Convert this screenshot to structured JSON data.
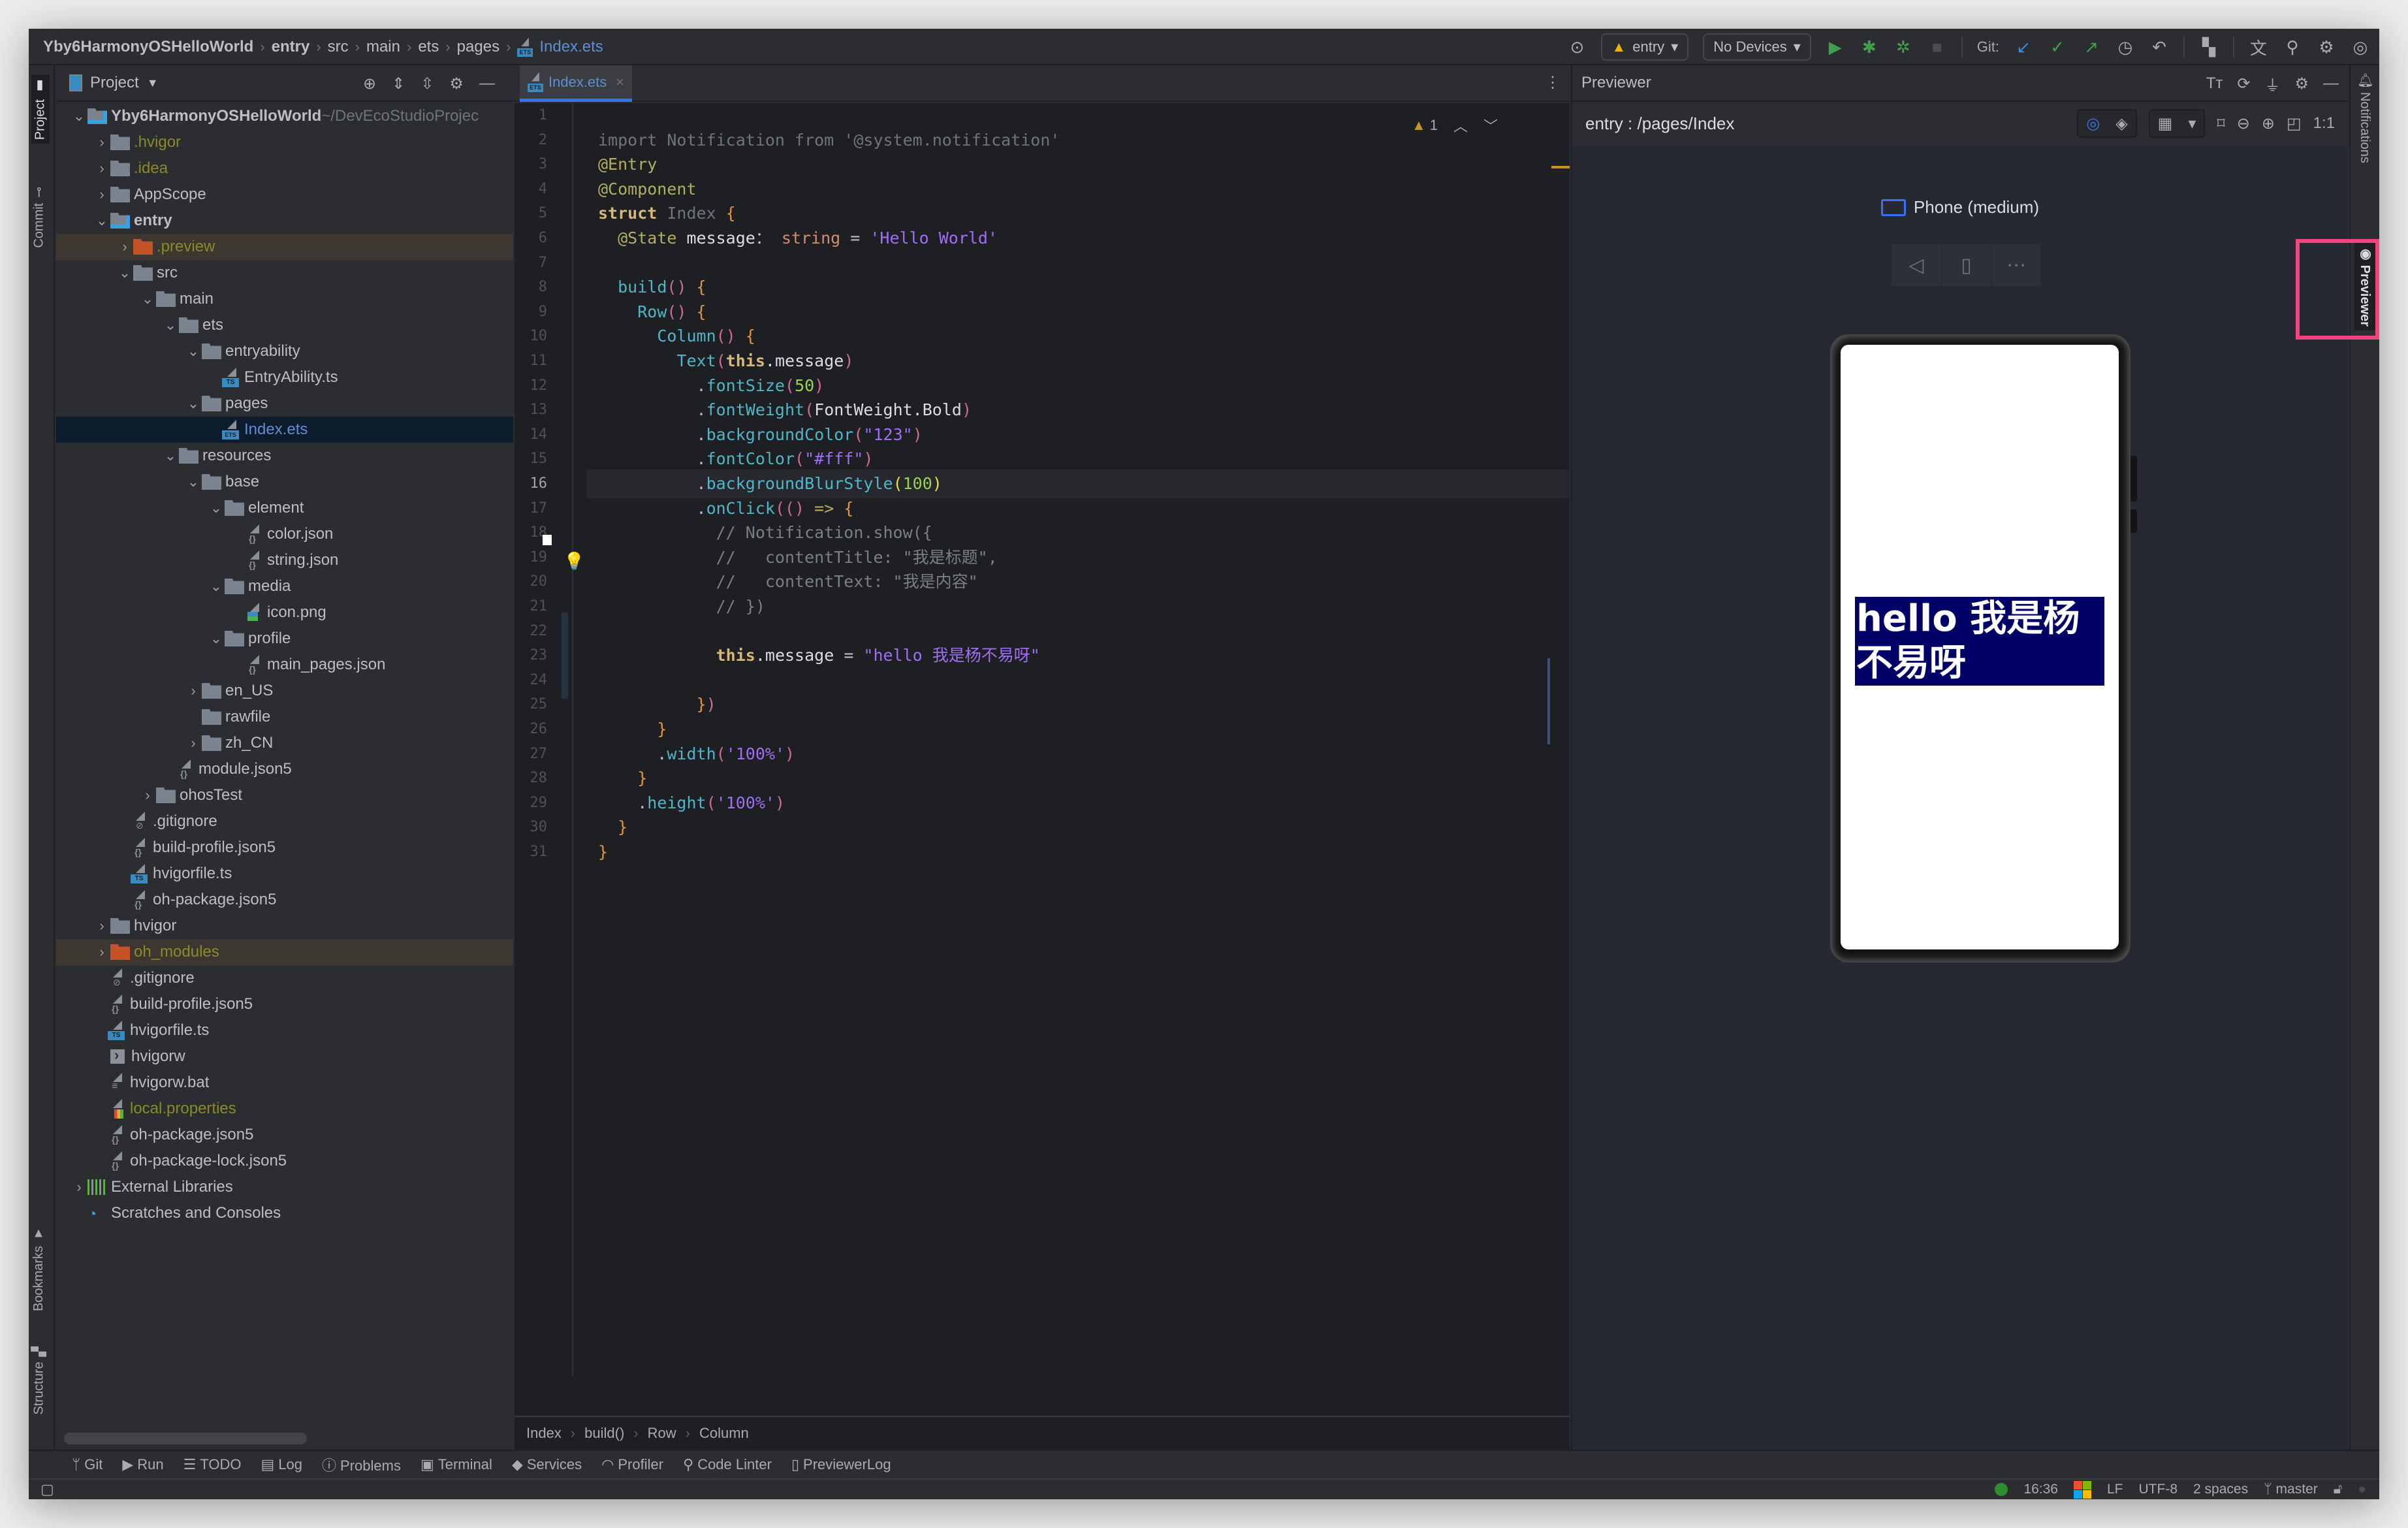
{
  "navbar": {
    "breadcrumb": [
      "Yby6HarmonyOSHelloWorld",
      "entry",
      "src",
      "main",
      "ets",
      "pages",
      "Index.ets"
    ],
    "module_selector": "entry",
    "device_selector": "No Devices",
    "git_label": "Git:"
  },
  "side_stripe_left": [
    "Project",
    "Commit",
    "Bookmarks",
    "Structure"
  ],
  "side_stripe_right": [
    "Notifications",
    "Previewer"
  ],
  "project": {
    "title": "Project",
    "tree": [
      {
        "depth": 0,
        "label": "Yby6HarmonyOSHelloWorld",
        "suffix": " ~/DevEcoStudioProjec",
        "type": "module",
        "chev": "down",
        "bold": true
      },
      {
        "depth": 1,
        "label": ".hvigor",
        "type": "folder",
        "chev": "right",
        "color": "olive"
      },
      {
        "depth": 1,
        "label": ".idea",
        "type": "folder",
        "chev": "right",
        "color": "olive"
      },
      {
        "depth": 1,
        "label": "AppScope",
        "type": "folder",
        "chev": "right"
      },
      {
        "depth": 1,
        "label": "entry",
        "type": "module",
        "chev": "down",
        "bold": true
      },
      {
        "depth": 2,
        "label": ".preview",
        "type": "folder-red",
        "chev": "right",
        "color": "olive",
        "hl": "brown"
      },
      {
        "depth": 2,
        "label": "src",
        "type": "folder",
        "chev": "down"
      },
      {
        "depth": 3,
        "label": "main",
        "type": "folder",
        "chev": "down"
      },
      {
        "depth": 4,
        "label": "ets",
        "type": "folder",
        "chev": "down"
      },
      {
        "depth": 5,
        "label": "entryability",
        "type": "folder",
        "chev": "down"
      },
      {
        "depth": 6,
        "label": "EntryAbility.ts",
        "type": "ts"
      },
      {
        "depth": 5,
        "label": "pages",
        "type": "folder",
        "chev": "down"
      },
      {
        "depth": 6,
        "label": "Index.ets",
        "type": "ets",
        "color": "blue",
        "hl": "sel"
      },
      {
        "depth": 4,
        "label": "resources",
        "type": "folder",
        "chev": "down"
      },
      {
        "depth": 5,
        "label": "base",
        "type": "folder",
        "chev": "down"
      },
      {
        "depth": 6,
        "label": "element",
        "type": "folder",
        "chev": "down"
      },
      {
        "depth": 7,
        "label": "color.json",
        "type": "json"
      },
      {
        "depth": 7,
        "label": "string.json",
        "type": "json"
      },
      {
        "depth": 6,
        "label": "media",
        "type": "folder",
        "chev": "down"
      },
      {
        "depth": 7,
        "label": "icon.png",
        "type": "img"
      },
      {
        "depth": 6,
        "label": "profile",
        "type": "folder",
        "chev": "down"
      },
      {
        "depth": 7,
        "label": "main_pages.json",
        "type": "json"
      },
      {
        "depth": 5,
        "label": "en_US",
        "type": "folder",
        "chev": "right"
      },
      {
        "depth": 5,
        "label": "rawfile",
        "type": "folder"
      },
      {
        "depth": 5,
        "label": "zh_CN",
        "type": "folder",
        "chev": "right"
      },
      {
        "depth": 4,
        "label": "module.json5",
        "type": "json"
      },
      {
        "depth": 3,
        "label": "ohosTest",
        "type": "folder",
        "chev": "right"
      },
      {
        "depth": 2,
        "label": ".gitignore",
        "type": "ign"
      },
      {
        "depth": 2,
        "label": "build-profile.json5",
        "type": "json"
      },
      {
        "depth": 2,
        "label": "hvigorfile.ts",
        "type": "ts"
      },
      {
        "depth": 2,
        "label": "oh-package.json5",
        "type": "json"
      },
      {
        "depth": 1,
        "label": "hvigor",
        "type": "folder",
        "chev": "right"
      },
      {
        "depth": 1,
        "label": "oh_modules",
        "type": "folder-red",
        "chev": "right",
        "color": "olive",
        "hl": "brown"
      },
      {
        "depth": 1,
        "label": ".gitignore",
        "type": "ign"
      },
      {
        "depth": 1,
        "label": "build-profile.json5",
        "type": "json"
      },
      {
        "depth": 1,
        "label": "hvigorfile.ts",
        "type": "ts"
      },
      {
        "depth": 1,
        "label": "hvigorw",
        "type": "sh"
      },
      {
        "depth": 1,
        "label": "hvigorw.bat",
        "type": "txt"
      },
      {
        "depth": 1,
        "label": "local.properties",
        "type": "prop",
        "color": "olive"
      },
      {
        "depth": 1,
        "label": "oh-package.json5",
        "type": "json"
      },
      {
        "depth": 1,
        "label": "oh-package-lock.json5",
        "type": "json"
      },
      {
        "depth": 0,
        "label": "External Libraries",
        "type": "lib",
        "chev": "right"
      },
      {
        "depth": 0,
        "label": "Scratches and Consoles",
        "type": "scratch"
      }
    ]
  },
  "editor": {
    "tab": "Index.ets",
    "warnings": "1",
    "current_line": 16,
    "lines": [
      [],
      [
        [
          "k-gray",
          "import "
        ],
        [
          "k-gray",
          "Notification "
        ],
        [
          "k-gray",
          "from "
        ],
        [
          "k-gray",
          "'@system.notification'"
        ]
      ],
      [
        [
          "k-ann",
          "@Entry"
        ]
      ],
      [
        [
          "k-ann",
          "@Component"
        ]
      ],
      [
        [
          "k-kw",
          "struct "
        ],
        [
          "k-gray",
          "Index "
        ],
        [
          "k-brace",
          "{"
        ]
      ],
      [
        [
          "",
          "  "
        ],
        [
          "k-ann",
          "@State "
        ],
        [
          "k-white",
          "message"
        ],
        [
          "",
          "： "
        ],
        [
          "k-type",
          "string"
        ],
        [
          "",
          " = "
        ],
        [
          "k-str",
          "'Hello World'"
        ]
      ],
      [],
      [
        [
          "",
          "  "
        ],
        [
          "k-cyan",
          "build"
        ],
        [
          "k-par",
          "()"
        ],
        [
          "",
          " "
        ],
        [
          "k-brace",
          "{"
        ]
      ],
      [
        [
          "",
          "    "
        ],
        [
          "k-cyan",
          "Row"
        ],
        [
          "k-par",
          "()"
        ],
        [
          "",
          " "
        ],
        [
          "k-brace",
          "{"
        ]
      ],
      [
        [
          "",
          "      "
        ],
        [
          "k-cyan",
          "Column"
        ],
        [
          "k-par",
          "()"
        ],
        [
          "",
          " "
        ],
        [
          "k-brace",
          "{"
        ]
      ],
      [
        [
          "",
          "        "
        ],
        [
          "k-cyan",
          "Text"
        ],
        [
          "k-par",
          "("
        ],
        [
          "k-kw",
          "this"
        ],
        [
          "k-white",
          ".message"
        ],
        [
          "k-par",
          ")"
        ]
      ],
      [
        [
          "",
          "          ."
        ],
        [
          "k-cyan",
          "fontSize"
        ],
        [
          "k-par",
          "("
        ],
        [
          "k-num",
          "50"
        ],
        [
          "k-par",
          ")"
        ]
      ],
      [
        [
          "",
          "          ."
        ],
        [
          "k-cyan",
          "fontWeight"
        ],
        [
          "k-par",
          "("
        ],
        [
          "k-white",
          "FontWeight.Bold"
        ],
        [
          "k-par",
          ")"
        ]
      ],
      [
        [
          "",
          "          ."
        ],
        [
          "k-cyan",
          "backgroundColor"
        ],
        [
          "k-par",
          "("
        ],
        [
          "k-str",
          "\"123\""
        ],
        [
          "k-par",
          ")"
        ]
      ],
      [
        [
          "",
          "          ."
        ],
        [
          "k-cyan",
          "fontColor"
        ],
        [
          "k-par",
          "("
        ],
        [
          "k-str",
          "\"#fff\""
        ],
        [
          "k-par",
          ")"
        ]
      ],
      [
        [
          "",
          "          ."
        ],
        [
          "k-cyan",
          "backgroundBlurStyle"
        ],
        [
          "k-ylw",
          "("
        ],
        [
          "k-num",
          "100"
        ],
        [
          "k-ylw",
          ")"
        ]
      ],
      [
        [
          "",
          "          ."
        ],
        [
          "k-cyan",
          "onClick"
        ],
        [
          "k-par",
          "(()"
        ],
        [
          "k-ann",
          " => "
        ],
        [
          "k-brace",
          "{"
        ]
      ],
      [
        [
          "",
          "            "
        ],
        [
          "k-cm",
          "// Notification.show({"
        ]
      ],
      [
        [
          "",
          "            "
        ],
        [
          "k-cm",
          "//   contentTitle: \"我是标题\","
        ]
      ],
      [
        [
          "",
          "            "
        ],
        [
          "k-cm",
          "//   contentText: \"我是内容\""
        ]
      ],
      [
        [
          "",
          "            "
        ],
        [
          "k-cm",
          "// })"
        ]
      ],
      [],
      [
        [
          "",
          "            "
        ],
        [
          "k-kw",
          "this"
        ],
        [
          "k-white",
          ".message"
        ],
        [
          "",
          " = "
        ],
        [
          "k-str",
          "\"hello 我是杨不易呀\""
        ]
      ],
      [],
      [
        [
          "",
          "          "
        ],
        [
          "k-brace",
          "}"
        ],
        [
          "k-par",
          ")"
        ]
      ],
      [
        [
          "",
          "      "
        ],
        [
          "k-brace",
          "}"
        ]
      ],
      [
        [
          "",
          "      ."
        ],
        [
          "k-cyan",
          "width"
        ],
        [
          "k-par",
          "("
        ],
        [
          "k-str",
          "'100%'"
        ],
        [
          "k-par",
          ")"
        ]
      ],
      [
        [
          "",
          "    "
        ],
        [
          "k-brace",
          "}"
        ]
      ],
      [
        [
          "",
          "    ."
        ],
        [
          "k-cyan",
          "height"
        ],
        [
          "k-par",
          "("
        ],
        [
          "k-str",
          "'100%'"
        ],
        [
          "k-par",
          ")"
        ]
      ],
      [
        [
          "",
          "  "
        ],
        [
          "k-brace",
          "}"
        ]
      ],
      [
        [
          "k-brace",
          "}"
        ]
      ]
    ],
    "breadcrumb": [
      "Index",
      "build()",
      "Row",
      "Column"
    ]
  },
  "previewer": {
    "title": "Previewer",
    "page_path": "entry : /pages/Index",
    "device_name": "Phone (medium)",
    "zoom_label": "1:1",
    "phone_text": "hello 我是杨不易呀",
    "phone_text_bg": "#000066"
  },
  "bottom_tools": [
    "Git",
    "Run",
    "TODO",
    "Log",
    "Problems",
    "Terminal",
    "Services",
    "Profiler",
    "Code Linter",
    "PreviewerLog"
  ],
  "status": {
    "time": "16:36",
    "line_sep": "LF",
    "encoding": "UTF-8",
    "indent": "2 spaces",
    "branch": "master"
  }
}
